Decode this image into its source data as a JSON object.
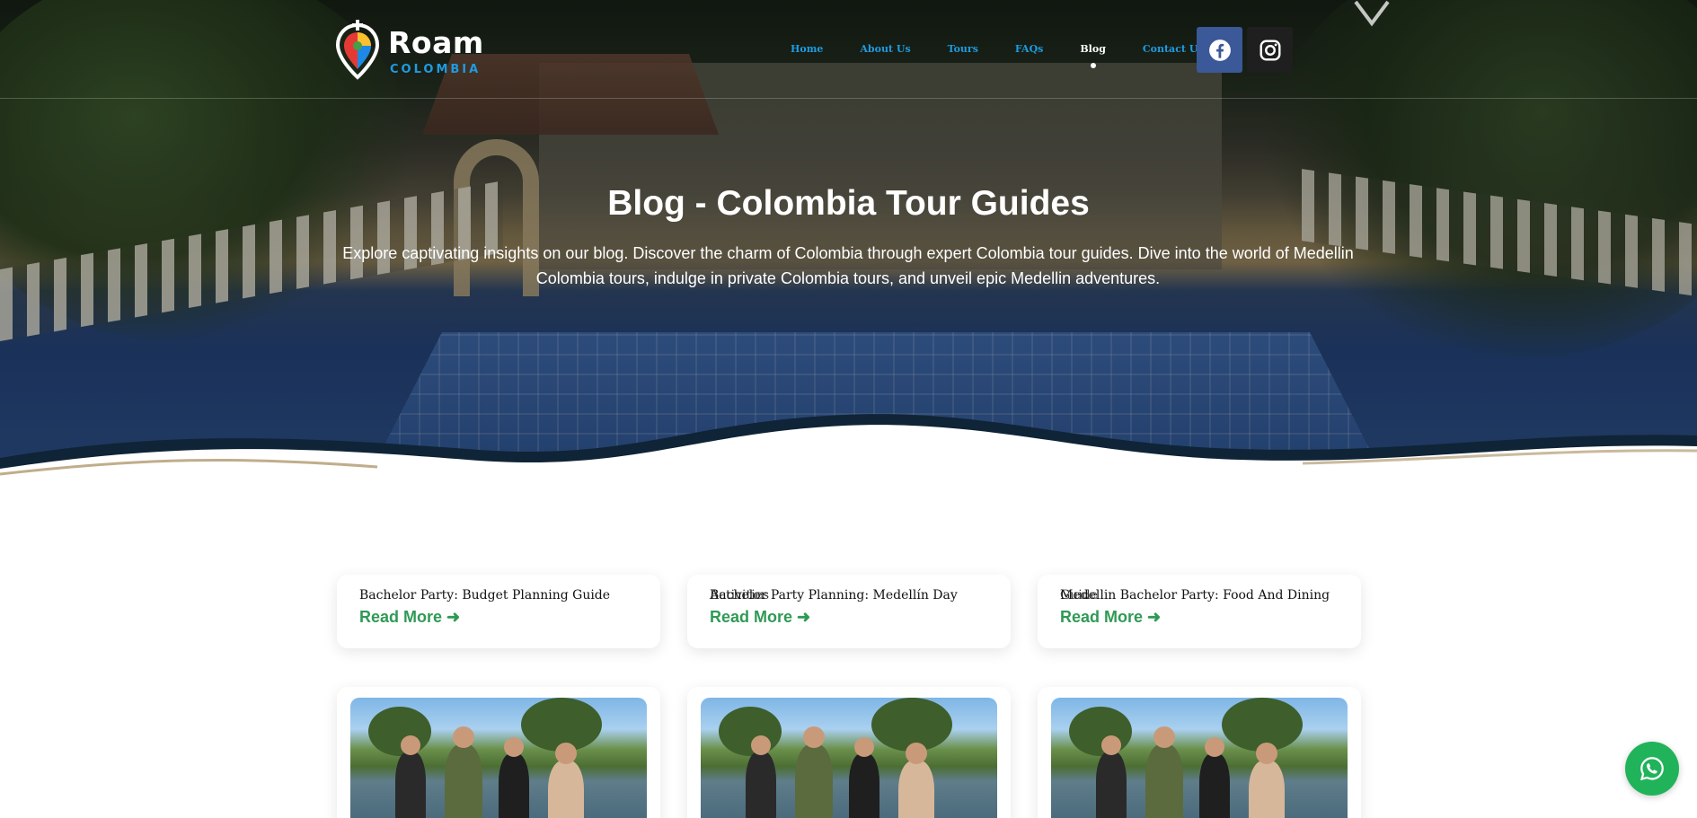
{
  "brand": {
    "name": "Roam",
    "subtitle": "COLOMBIA"
  },
  "nav": {
    "items": [
      {
        "label": "Home",
        "active": false
      },
      {
        "label": "About Us",
        "active": false
      },
      {
        "label": "Tours",
        "active": false
      },
      {
        "label": "FAQs",
        "active": false
      },
      {
        "label": "Blog",
        "active": true
      },
      {
        "label": "Contact Us",
        "active": false
      }
    ]
  },
  "social": {
    "facebook_icon": "facebook-icon",
    "instagram_icon": "instagram-icon",
    "facebook_color": "#3b5998",
    "instagram_color": "#1f1f1f"
  },
  "hero": {
    "title": "Blog - Colombia Tour Guides",
    "description": "Explore captivating insights on our blog. Discover the charm of Colombia through expert Colombia tour guides. Dive into the world of Medellin Colombia tours, indulge in private Colombia tours, and unveil epic Medellin adventures."
  },
  "cards": [
    {
      "title": "Bachelor Party: Budget Planning Guide",
      "overlap_text": "",
      "read_more": "Read More ➜"
    },
    {
      "title": "Bachelor Party Planning: Medellín Day",
      "overlap_text": "Activities",
      "read_more": "Read More ➜"
    },
    {
      "title": "Medellin Bachelor Party: Food And Dining",
      "overlap_text": "Guide",
      "read_more": "Read More ➜"
    }
  ],
  "colors": {
    "accent_blue": "#1e9be0",
    "read_more_green": "#2f9a55",
    "whatsapp_green": "#21b35a"
  },
  "whatsapp": {
    "icon": "whatsapp-icon"
  }
}
